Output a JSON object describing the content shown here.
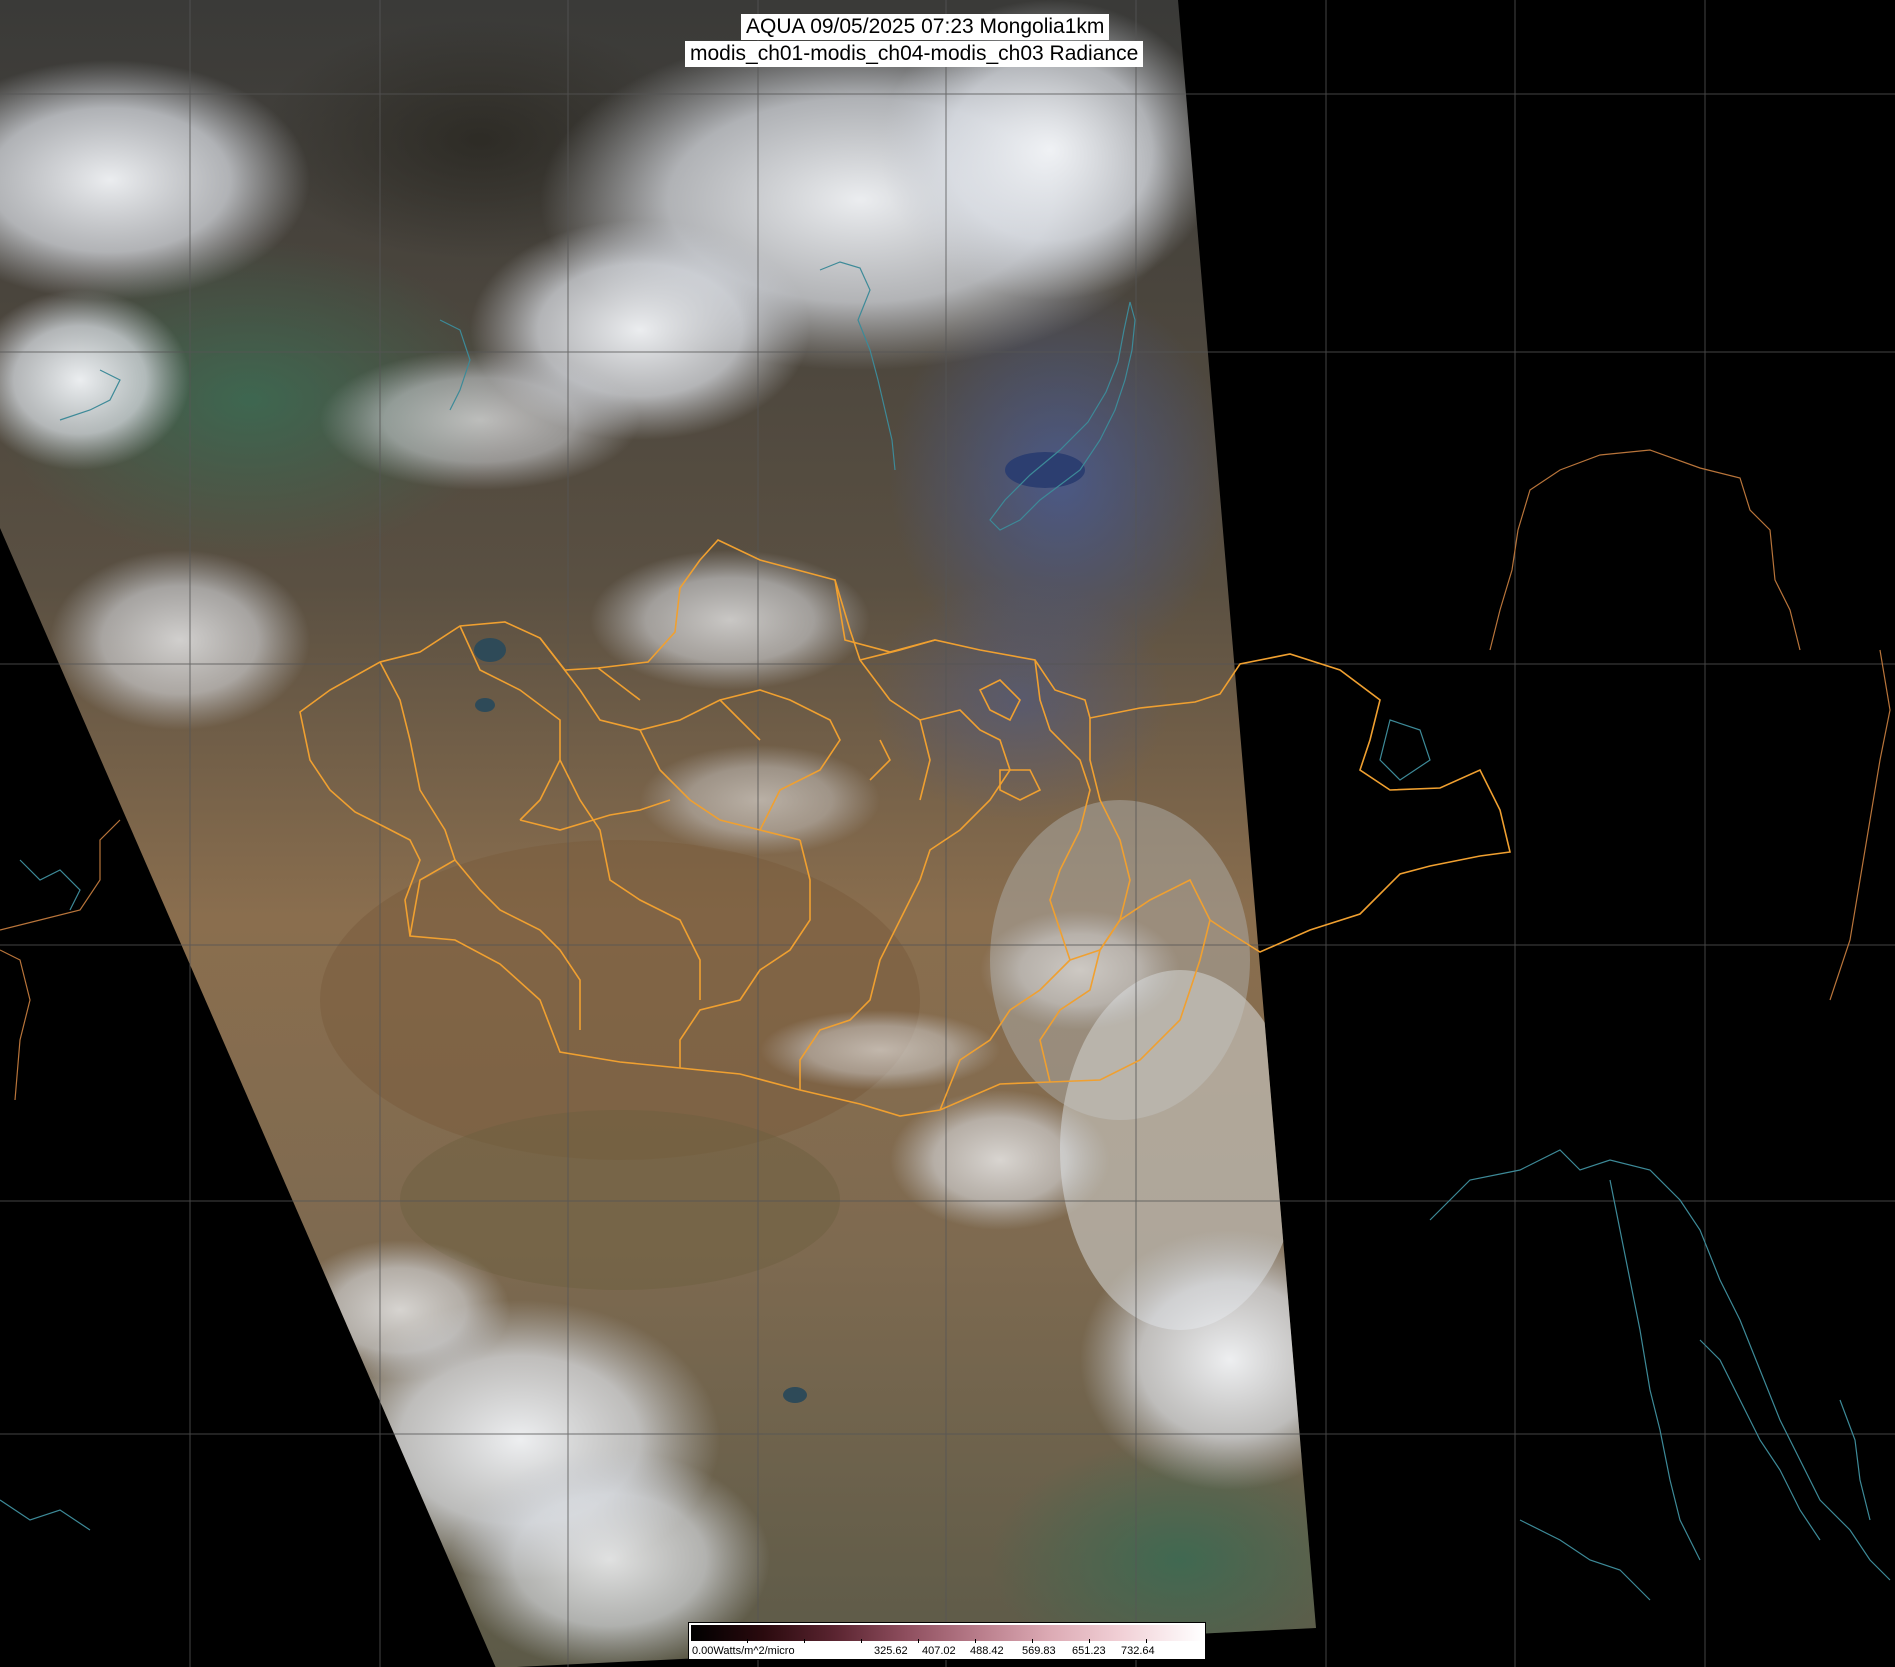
{
  "title": {
    "line1": "AQUA 09/05/2025 07:23 Mongolia1km",
    "line2": "modis_ch01-modis_ch04-modis_ch03 Radiance"
  },
  "colorbar": {
    "unit_label": "0.00Watts/m^2/micro",
    "tick_labels": [
      "325.62",
      "407.02",
      "488.42",
      "569.83",
      "651.23",
      "732.64"
    ]
  },
  "colors": {
    "background": "#000000",
    "province_border": "#f0a030",
    "country_border_outside": "#b8743a",
    "coastline": "#3d8a98",
    "graticule": "#555555",
    "cloud": "#eef0f4",
    "desert": "#8b7355"
  },
  "map_features": [
    "satellite-swath",
    "graticule",
    "province-borders",
    "coastlines",
    "cloud-cover",
    "colorbar"
  ]
}
